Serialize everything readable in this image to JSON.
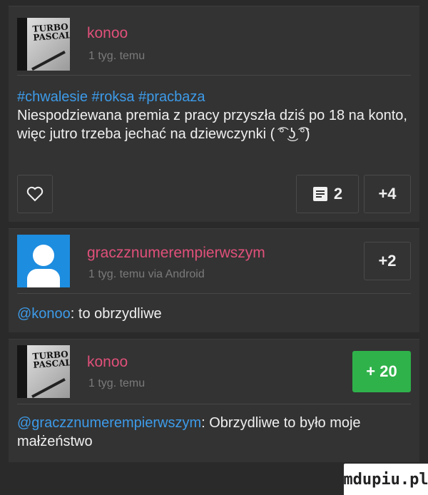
{
  "comments": [
    {
      "username": "konoo",
      "time": "1 tyg. temu",
      "tags": [
        "#chwalesie",
        "#roksa",
        "#pracbaza"
      ],
      "text": "Niespodziewana premia z pracy przyszła dziś po 18 na konto, więc jutro trzeba jechać na dziewczynki ( ͡° ͜ʖ ͡°)",
      "comment_count": "2",
      "vote": "+4"
    },
    {
      "username": "graczznumerempierwszym",
      "time": "1 tyg. temu via Android",
      "vote": "+2",
      "mention": "@konoo",
      "text": ": to obrzydliwe"
    },
    {
      "username": "konoo",
      "time": "1 tyg. temu",
      "vote": "+ 20",
      "mention": "@graczznumerempierwszym",
      "text": ": Obrzydliwe to było moje małżeństwo"
    }
  ],
  "watermark": "mdupiu.pl",
  "colors": {
    "username": "#e0507a",
    "link": "#3d9be9",
    "vote_green": "#2fb24a"
  }
}
